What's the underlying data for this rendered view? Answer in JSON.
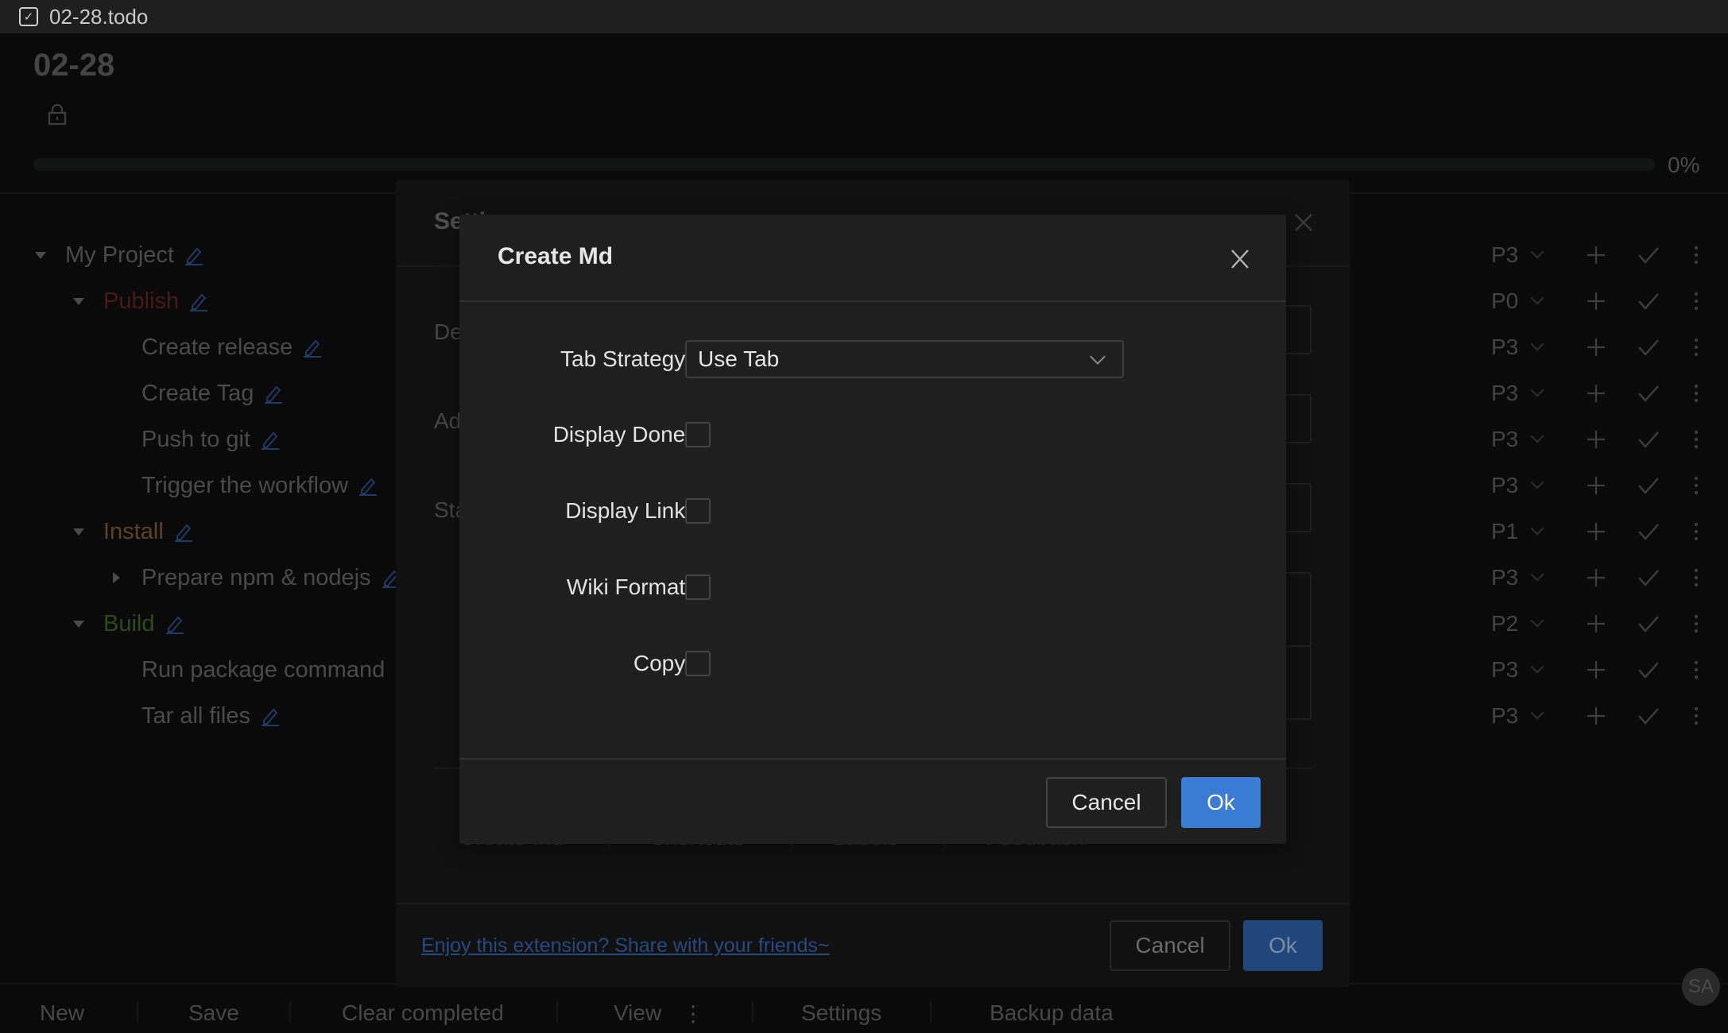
{
  "window": {
    "tab_title": "02-28.todo",
    "tab_icon": "checkbox-icon"
  },
  "page": {
    "title": "02-28",
    "lock_icon": "lock-icon",
    "progress": {
      "percent": 0,
      "label": "0%"
    }
  },
  "tree": [
    {
      "label": "My Project",
      "level": 0,
      "expand": "down",
      "color": "#4a4a4a",
      "priority": "P3"
    },
    {
      "label": "Publish",
      "level": 1,
      "expand": "down",
      "color": "#4a1a1a",
      "priority": "P0"
    },
    {
      "label": "Create release",
      "level": 2,
      "expand": "none",
      "color": "#4a4a4a",
      "priority": "P3"
    },
    {
      "label": "Create Tag",
      "level": 2,
      "expand": "none",
      "color": "#4a4a4a",
      "priority": "P3"
    },
    {
      "label": "Push to git",
      "level": 2,
      "expand": "none",
      "color": "#4a4a4a",
      "priority": "P3"
    },
    {
      "label": "Trigger the workflow",
      "level": 2,
      "expand": "none",
      "color": "#4a4a4a",
      "priority": "P3"
    },
    {
      "label": "Install",
      "level": 1,
      "expand": "down",
      "color": "#5a4520",
      "priority": "P1"
    },
    {
      "label": "Prepare npm & nodejs",
      "level": 2,
      "expand": "right",
      "color": "#4a4a4a",
      "priority": "P3"
    },
    {
      "label": "Build",
      "level": 1,
      "expand": "down",
      "color": "#2e4a1e",
      "priority": "P2"
    },
    {
      "label": "Run package command",
      "level": 2,
      "expand": "none",
      "color": "#4a4a4a",
      "priority": "P3"
    },
    {
      "label": "Tar all files",
      "level": 2,
      "expand": "none",
      "color": "#4a4a4a",
      "priority": "P3"
    }
  ],
  "bottombar": {
    "items": [
      "New",
      "Save",
      "Clear completed",
      "View",
      "Settings",
      "Backup data"
    ],
    "view_more": "⋮",
    "avatar": "SA"
  },
  "settings_dialog": {
    "title": "Settings",
    "fields": [
      "Default",
      "Add",
      "Status"
    ],
    "tabs": [
      "Create Md",
      "Shortcuts",
      "Labels",
      "Feedback"
    ],
    "share_link": "Enjoy this extension? Share with your friends~",
    "cancel": "Cancel",
    "ok": "Ok"
  },
  "create_md_dialog": {
    "title": "Create Md",
    "tab_strategy": {
      "label": "Tab Strategy",
      "value": "Use Tab"
    },
    "options": [
      {
        "label": "Display Done",
        "checked": false
      },
      {
        "label": "Display Link",
        "checked": false
      },
      {
        "label": "Wiki Format",
        "checked": false
      },
      {
        "label": "Copy",
        "checked": false
      }
    ],
    "colon": ":",
    "cancel": "Cancel",
    "ok": "Ok"
  },
  "colors": {
    "accent": "#3a7bd5",
    "link": "#264a7e",
    "edit_icon": "#1f3a66"
  }
}
